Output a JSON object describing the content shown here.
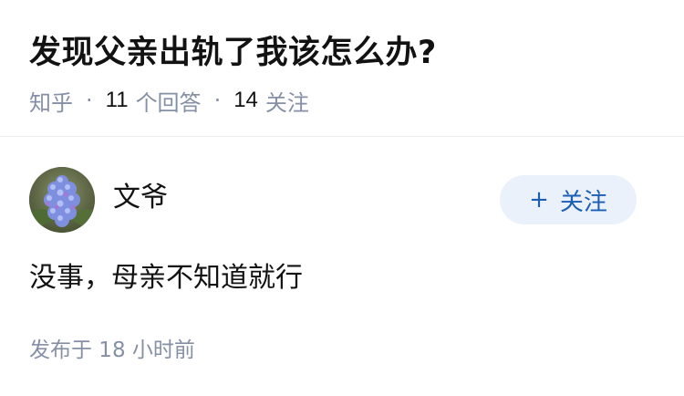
{
  "question": {
    "title": "发现父亲出轨了我该怎么办?",
    "source": "知乎",
    "separator": "·",
    "answers_count": "11",
    "answers_label": "个回答",
    "follows_count": "14",
    "follows_label": "关注"
  },
  "answer": {
    "author": {
      "name": "文爷",
      "avatar_icon": "hydrangea-flower-photo"
    },
    "follow_button": {
      "icon": "+",
      "label": "关注"
    },
    "content": "没事，母亲不知道就行",
    "time": "发布于 18 小时前"
  },
  "colors": {
    "text": "#121212",
    "muted": "#8590a6",
    "follow_text": "#1a5fb4",
    "follow_bg": "#ebf1fa",
    "divider": "#ebebeb"
  }
}
